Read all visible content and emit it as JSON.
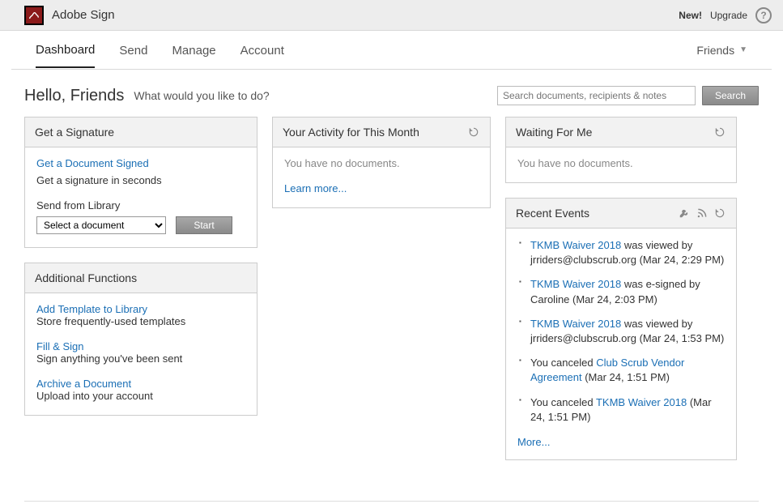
{
  "app": {
    "name": "Adobe Sign"
  },
  "topbar": {
    "new": "New!",
    "upgrade": "Upgrade",
    "help": "?"
  },
  "nav": {
    "tabs": [
      "Dashboard",
      "Send",
      "Manage",
      "Account"
    ],
    "user": "Friends"
  },
  "greeting": {
    "hello": "Hello, Friends",
    "sub": "What would you like to do?"
  },
  "search": {
    "placeholder": "Search documents, recipients & notes",
    "button": "Search"
  },
  "panels": {
    "signature": {
      "title": "Get a Signature",
      "link": "Get a Document Signed",
      "desc": "Get a signature in seconds",
      "sendFrom": "Send from Library",
      "selectPlaceholder": "Select a document",
      "start": "Start"
    },
    "additional": {
      "title": "Additional Functions",
      "items": [
        {
          "link": "Add Template to Library",
          "desc": "Store frequently-used templates"
        },
        {
          "link": "Fill & Sign",
          "desc": "Sign anything you've been sent"
        },
        {
          "link": "Archive a Document",
          "desc": "Upload into your account"
        }
      ]
    },
    "activity": {
      "title": "Your Activity for This Month",
      "empty": "You have no documents.",
      "learn": "Learn more..."
    },
    "waiting": {
      "title": "Waiting For Me",
      "empty": "You have no documents."
    },
    "recent": {
      "title": "Recent Events",
      "events": [
        {
          "pre": "",
          "link": "TKMB Waiver 2018",
          "post": "  was viewed by jrriders@clubscrub.org (Mar 24, 2:29 PM)"
        },
        {
          "pre": "",
          "link": "TKMB Waiver 2018",
          "post": "  was e-signed by Caroline (Mar 24, 2:03 PM)"
        },
        {
          "pre": "",
          "link": "TKMB Waiver 2018",
          "post": "  was viewed by jrriders@clubscrub.org (Mar 24, 1:53 PM)"
        },
        {
          "pre": "You canceled ",
          "link": "Club Scrub Vendor Agreement",
          "post": "  (Mar 24, 1:51 PM)"
        },
        {
          "pre": "You canceled ",
          "link": "TKMB Waiver 2018",
          "post": "  (Mar 24, 1:51 PM)"
        }
      ],
      "more": "More..."
    }
  }
}
